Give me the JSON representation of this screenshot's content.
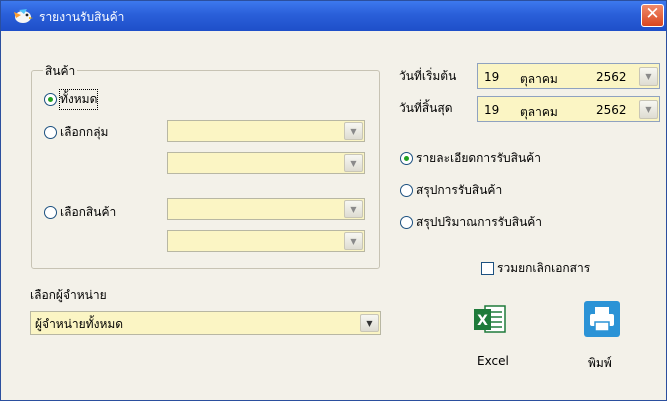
{
  "window": {
    "title": "รายงานรับสินค้า"
  },
  "product_group": {
    "legend": "สินค้า",
    "options": [
      {
        "label": "ทั้งหมด",
        "selected": true
      },
      {
        "label": "เลือกกลุ่ม",
        "selected": false
      },
      {
        "label": "เลือกสินค้า",
        "selected": false
      }
    ]
  },
  "date": {
    "start_label": "วันที่เริ่มต้น",
    "start": {
      "day": "19",
      "month": "ตุลาคม",
      "year": "2562"
    },
    "end_label": "วันที่สิ้นสุด",
    "end": {
      "day": "19",
      "month": "ตุลาคม",
      "year": "2562"
    }
  },
  "report_types": [
    {
      "label": "รายละเอียดการรับสินค้า",
      "selected": true
    },
    {
      "label": "สรุปการรับสินค้า",
      "selected": false
    },
    {
      "label": "สรุปปริมาณการรับสินค้า",
      "selected": false
    }
  ],
  "include_cancelled": {
    "label": "รวมยกเลิกเอกสาร",
    "checked": false
  },
  "supplier": {
    "label": "เลือกผู้จำหน่าย",
    "value": "ผู้จำหน่ายทั้งหมด"
  },
  "actions": {
    "excel_label": "Excel",
    "print_label": "พิมพ์"
  },
  "colors": {
    "titlebar": "#2a5fd9",
    "field_bg": "#fbf5c4",
    "panel_bg": "#f3f1e9"
  }
}
